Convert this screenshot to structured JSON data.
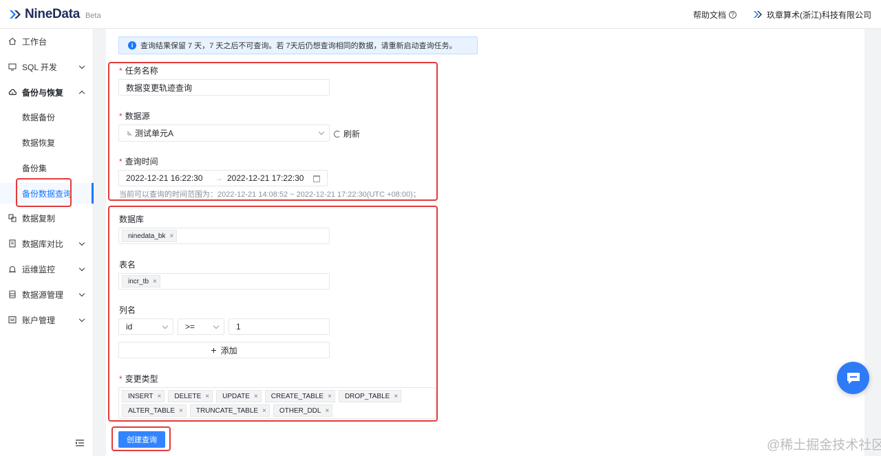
{
  "header": {
    "logo_text": "NineData",
    "beta": "Beta",
    "help_label": "帮助文档",
    "help_icon_glyph": "?",
    "org_name": "玖章算术(浙江)科技有限公司",
    "brand_color": "#1677ff"
  },
  "sidebar": {
    "items": [
      {
        "label": "工作台",
        "icon": "home-icon"
      },
      {
        "label": "SQL 开发",
        "icon": "monitor-icon"
      },
      {
        "label": "备份与恢复",
        "icon": "cloud-icon"
      },
      {
        "label": "数据复制",
        "icon": "copy-icon"
      },
      {
        "label": "数据库对比",
        "icon": "compare-icon"
      },
      {
        "label": "运维监控",
        "icon": "alarm-icon"
      },
      {
        "label": "数据源管理",
        "icon": "datasource-icon"
      },
      {
        "label": "账户管理",
        "icon": "account-icon"
      }
    ],
    "sub_items": [
      {
        "label": "数据备份"
      },
      {
        "label": "数据恢复"
      },
      {
        "label": "备份集"
      },
      {
        "label": "备份数据查询",
        "active": true
      }
    ]
  },
  "notice": {
    "icon_glyph": "i",
    "text": "查询结果保留 7 天，7 天之后不可查询。若 7天后仍想查询相同的数据，请重新启动查询任务。"
  },
  "form": {
    "required_mark": "*",
    "task_name_label": "任务名称",
    "task_name_value": "数据变更轨迹查询",
    "datasource_label": "数据源",
    "datasource_value": "测试单元A",
    "refresh_label": "刷新",
    "query_time_label": "查询时间",
    "start_time": "2022-12-21 16:22:30",
    "end_time": "2022-12-21 17:22:30",
    "range_arrow": "→",
    "time_hint": "当前可以查询的时间范围为：2022-12-21 14:08:52 ~ 2022-12-21 17:22:30(UTC +08:00)；",
    "database_label": "数据库",
    "database_tags": [
      "ninedata_bk"
    ],
    "table_label": "表名",
    "table_tags": [
      "incr_tb"
    ],
    "column_label": "列名",
    "column_field": "id",
    "column_operator": ">=",
    "column_value": "1",
    "add_glyph": "+",
    "add_label": "添加",
    "change_type_label": "变更类型",
    "change_types_row1": [
      "INSERT",
      "DELETE",
      "UPDATE",
      "CREATE_TABLE",
      "DROP_TABLE"
    ],
    "change_types_row2": [
      "ALTER_TABLE",
      "TRUNCATE_TABLE",
      "OTHER_DDL"
    ],
    "tag_close": "×",
    "submit_label": "创建查询"
  },
  "watermark": "@稀土掘金技术社区"
}
